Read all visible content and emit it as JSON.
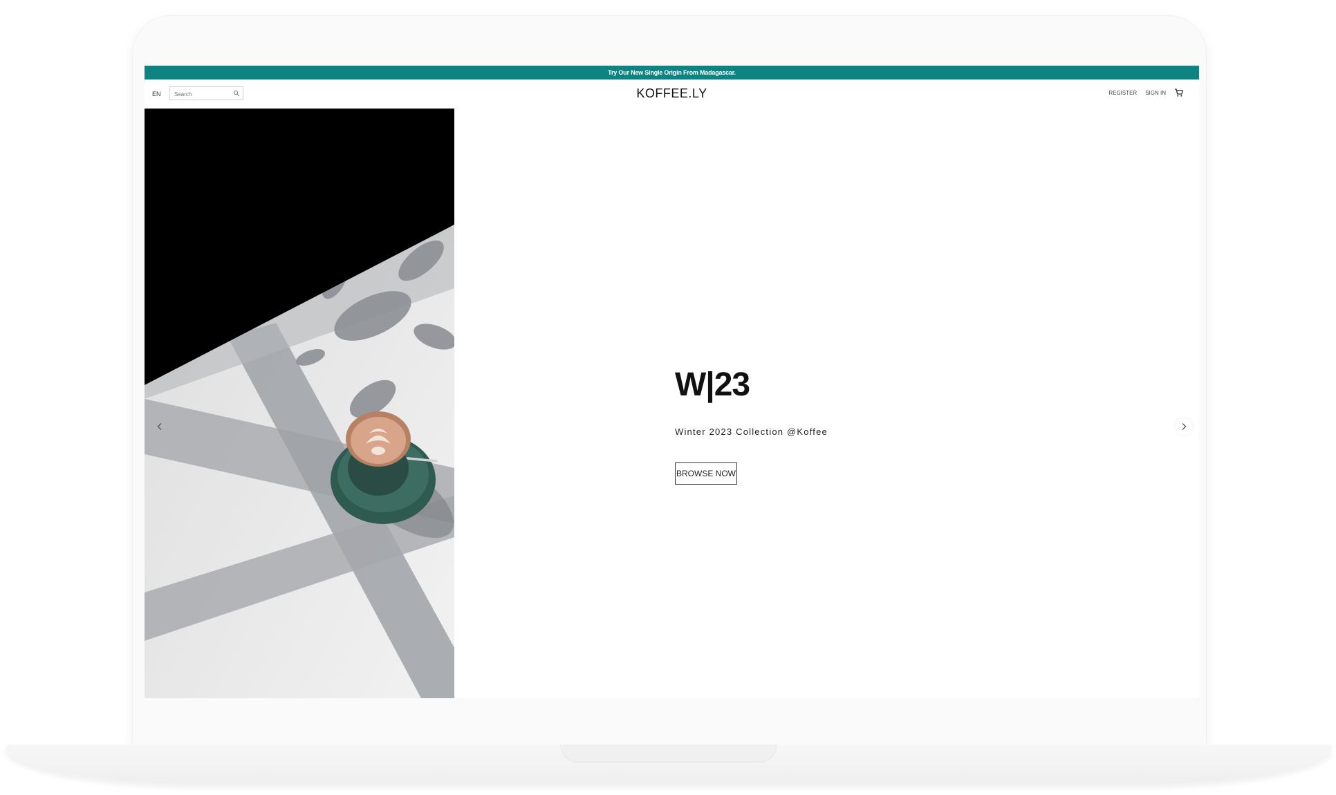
{
  "promo": {
    "text": "Try Our New Single Origin From Madagascar."
  },
  "header": {
    "language": "EN",
    "search_placeholder": "Search",
    "logo": "KOFFEE.LY",
    "register_label": "REGISTER",
    "signin_label": "SIGN IN"
  },
  "hero": {
    "title": "W|23",
    "subtitle": "Winter 2023 Collection @Koffee",
    "button_label": "BROWSE NOW"
  },
  "colors": {
    "promo_bar": "#0e8482",
    "text": "#111111"
  },
  "icons": [
    "search-icon",
    "cart-icon",
    "chevron-left-icon",
    "chevron-right-icon"
  ]
}
